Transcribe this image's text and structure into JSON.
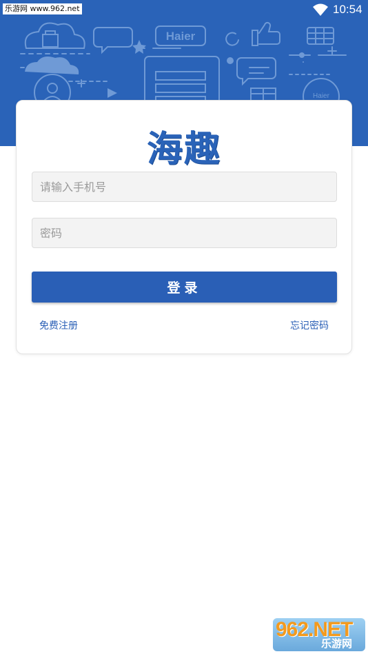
{
  "status_bar": {
    "watermark": "乐游网 www.962.net",
    "time": "10:54"
  },
  "header": {
    "brand_text": "Haier",
    "brand_text_small": "Haier",
    "background_color": "#2a63b8"
  },
  "login_card": {
    "logo": "海趣",
    "phone_placeholder": "请输入手机号",
    "password_placeholder": "密码",
    "login_button": "登录",
    "register_link": "免费注册",
    "forgot_password_link": "忘记密码"
  },
  "watermark_bottom": {
    "big": "962.NET",
    "small": "乐游网"
  },
  "icons": [
    "wifi-icon",
    "cloud-icon",
    "chat-bubble-icon",
    "star-icon",
    "thumbs-up-icon",
    "refresh-icon",
    "table-icon",
    "gift-icon",
    "play-icon",
    "phone-icon",
    "user-icon"
  ]
}
